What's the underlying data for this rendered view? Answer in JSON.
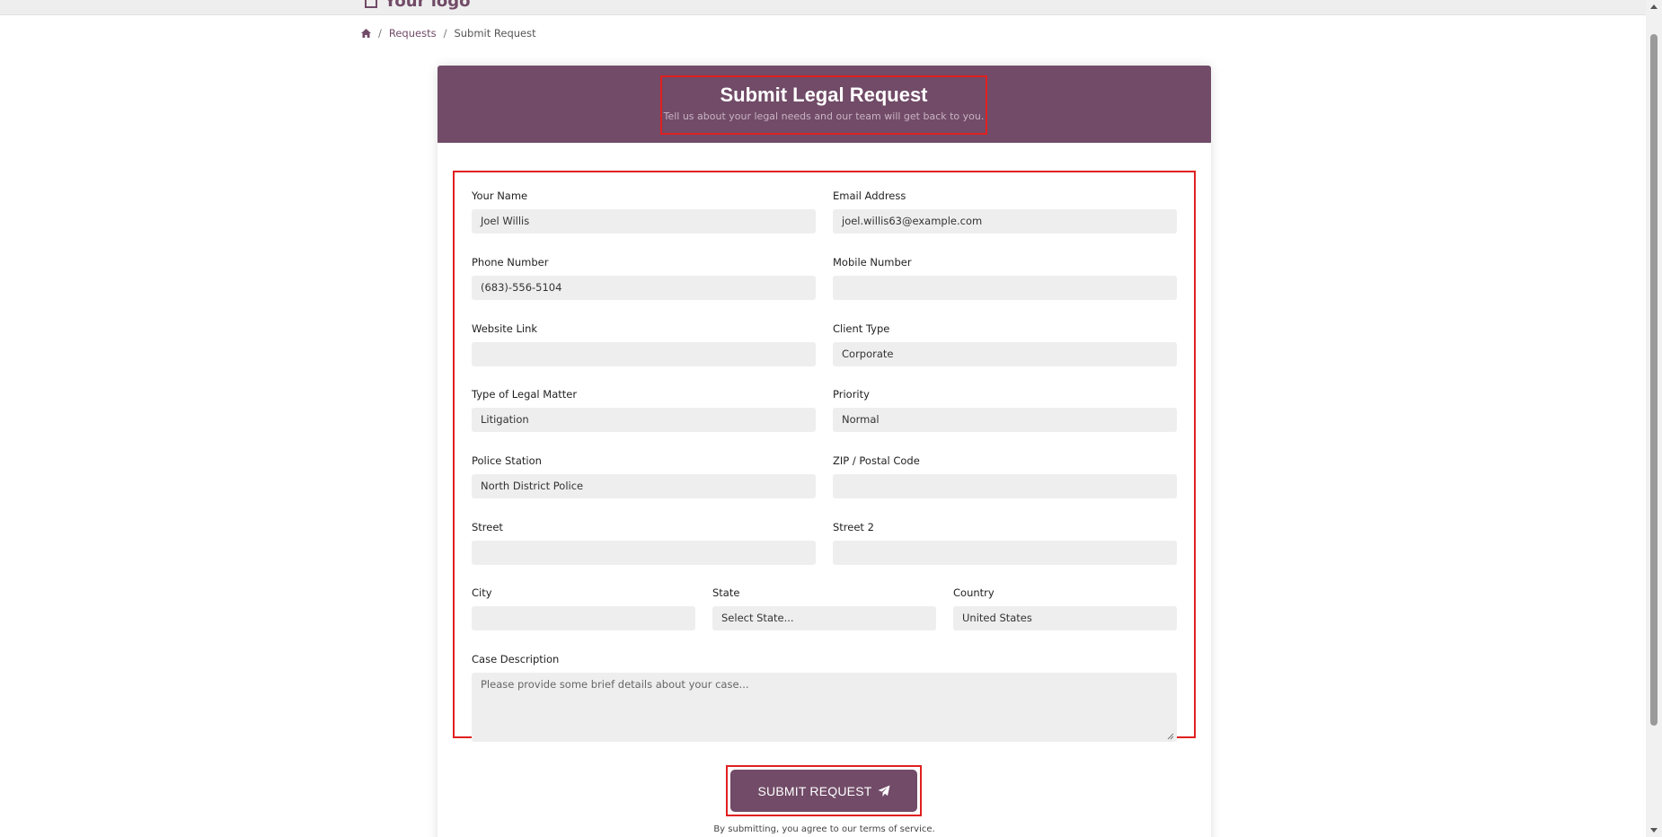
{
  "topbar": {
    "logo_text": "Your logo"
  },
  "breadcrumb": {
    "home_icon": "home-icon",
    "requests": "Requests",
    "sep": "/",
    "current": "Submit Request"
  },
  "header": {
    "title": "Submit Legal Request",
    "subtitle": "Tell us about your legal needs and our team will get back to you."
  },
  "form": {
    "name": {
      "label": "Your Name",
      "value": "Joel Willis"
    },
    "email": {
      "label": "Email Address",
      "value": "joel.willis63@example.com"
    },
    "phone": {
      "label": "Phone Number",
      "value": "(683)-556-5104"
    },
    "mobile": {
      "label": "Mobile Number",
      "value": ""
    },
    "website": {
      "label": "Website Link",
      "value": ""
    },
    "client_type": {
      "label": "Client Type",
      "value": "Corporate"
    },
    "matter_type": {
      "label": "Type of Legal Matter",
      "value": "Litigation"
    },
    "priority": {
      "label": "Priority",
      "value": "Normal"
    },
    "police_station": {
      "label": "Police Station",
      "value": "North District Police"
    },
    "zip": {
      "label": "ZIP / Postal Code",
      "value": ""
    },
    "street": {
      "label": "Street",
      "value": ""
    },
    "street2": {
      "label": "Street 2",
      "value": ""
    },
    "city": {
      "label": "City",
      "value": ""
    },
    "state": {
      "label": "State",
      "value": "Select State..."
    },
    "country": {
      "label": "Country",
      "value": "United States"
    },
    "description": {
      "label": "Case Description",
      "placeholder": "Please provide some brief details about your case..."
    }
  },
  "submit": {
    "label": "SUBMIT REQUEST",
    "icon": "paper-plane-icon"
  },
  "terms": "By submitting, you agree to our terms of service.",
  "colors": {
    "brand": "#714b67",
    "highlight": "#e02020",
    "input_bg": "#eeeeee"
  }
}
